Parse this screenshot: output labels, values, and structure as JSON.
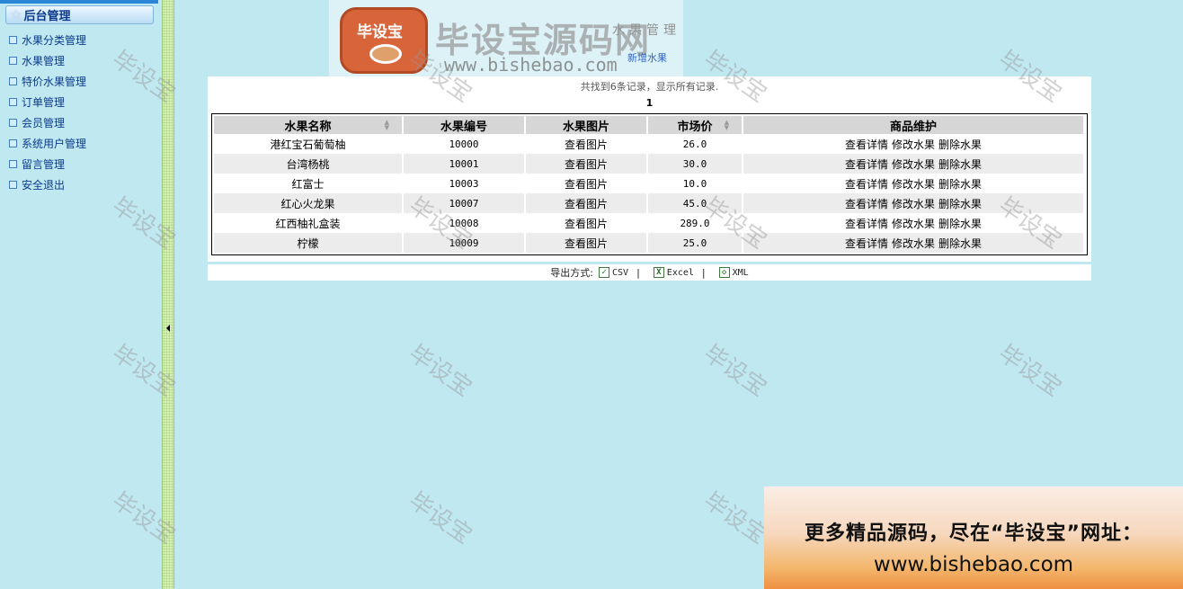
{
  "sidebar": {
    "header": "后台管理",
    "items": [
      "水果分类管理",
      "水果管理",
      "特价水果管理",
      "订单管理",
      "会员管理",
      "系统用户管理",
      "留言管理",
      "安全退出"
    ]
  },
  "main": {
    "title": "水果管理",
    "add_link": "新增水果",
    "summary": "共找到6条记录，显示所有记录.",
    "page_number": "1",
    "columns": [
      "水果名称",
      "水果编号",
      "水果图片",
      "市场价",
      "商品维护"
    ],
    "rows": [
      {
        "name": "港红宝石葡萄柚",
        "code": "10000",
        "image": "查看图片",
        "price": "26.0"
      },
      {
        "name": "台湾杨桃",
        "code": "10001",
        "image": "查看图片",
        "price": "30.0"
      },
      {
        "name": "红富士",
        "code": "10003",
        "image": "查看图片",
        "price": "10.0"
      },
      {
        "name": "红心火龙果",
        "code": "10007",
        "image": "查看图片",
        "price": "45.0"
      },
      {
        "name": "红西柚礼盒装",
        "code": "10008",
        "image": "查看图片",
        "price": "289.0"
      },
      {
        "name": "柠檬",
        "code": "10009",
        "image": "查看图片",
        "price": "25.0"
      }
    ],
    "actions": {
      "detail": "查看详情",
      "edit": "修改水果",
      "delete": "删除水果"
    },
    "export": {
      "label": "导出方式:",
      "csv": "CSV",
      "excel": "Excel",
      "xml": "XML",
      "sep": "|"
    }
  },
  "watermark": {
    "text": "毕设宝",
    "logo_name": "毕设宝源码网",
    "logo_url": "www.bishebao.com",
    "logo_badge": "毕设宝"
  },
  "banner": {
    "line1": "更多精品源码，尽在“毕设宝”网址：",
    "line2": "www.bishebao.com"
  },
  "colors": {
    "background": "#c0e8f1",
    "header_row": "#d6d6d6",
    "alt_row": "#ececec",
    "sidebar_text": "#0a3a8c"
  }
}
